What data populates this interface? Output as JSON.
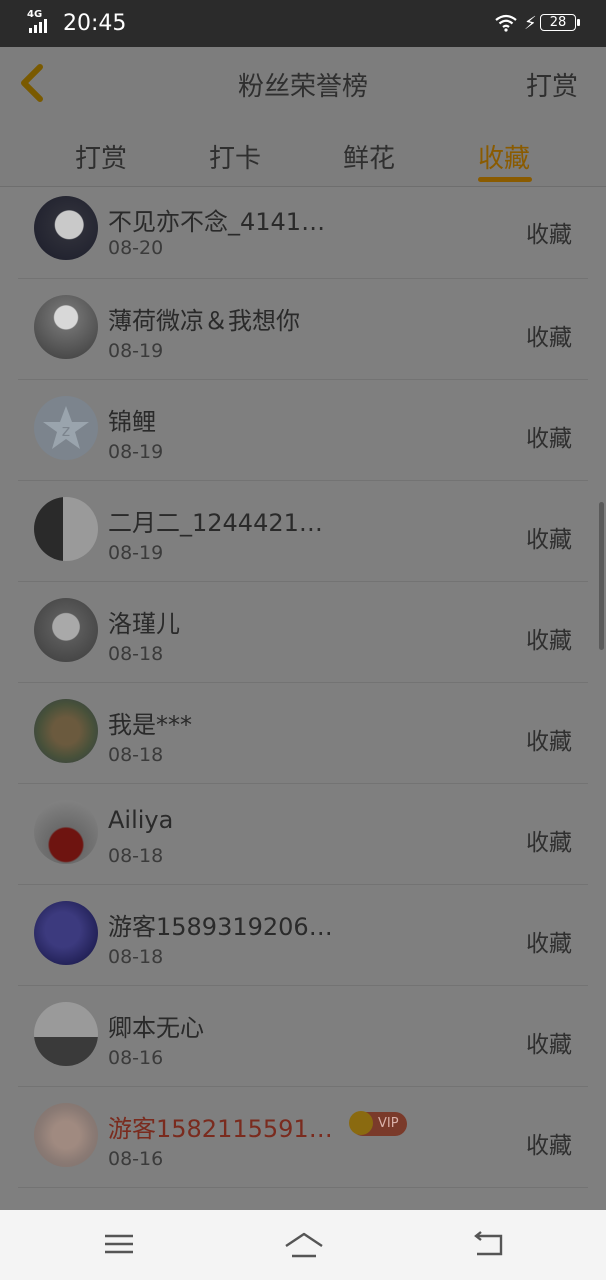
{
  "status_bar": {
    "network": "4G",
    "time": "20:45",
    "battery": "28"
  },
  "header": {
    "title": "粉丝荣誉榜",
    "right_action": "打赏"
  },
  "tabs": [
    {
      "label": "打赏",
      "active": false
    },
    {
      "label": "打卡",
      "active": false
    },
    {
      "label": "鲜花",
      "active": false
    },
    {
      "label": "收藏",
      "active": true
    }
  ],
  "rows": [
    {
      "name": "不见亦不念_4141…",
      "date": "08-20",
      "action": "收藏"
    },
    {
      "name": "薄荷微凉＆我想你",
      "date": "08-19",
      "action": "收藏"
    },
    {
      "name": "锦鲤",
      "date": "08-19",
      "action": "收藏"
    },
    {
      "name": "二月二_1244421…",
      "date": "08-19",
      "action": "收藏"
    },
    {
      "name": "洛瑾儿",
      "date": "08-18",
      "action": "收藏"
    },
    {
      "name": "我是***",
      "date": "08-18",
      "action": "收藏"
    },
    {
      "name": "Ailiya",
      "date": "08-18",
      "action": "收藏"
    },
    {
      "name": "游客1589319206…",
      "date": "08-18",
      "action": "收藏"
    },
    {
      "name": "卿本无心",
      "date": "08-16",
      "action": "收藏"
    },
    {
      "name": "游客1582115591…",
      "date": "08-16",
      "action": "收藏",
      "vip": "VIP"
    }
  ],
  "colors": {
    "accent": "#f5a000",
    "vip_name": "#e53a22"
  }
}
